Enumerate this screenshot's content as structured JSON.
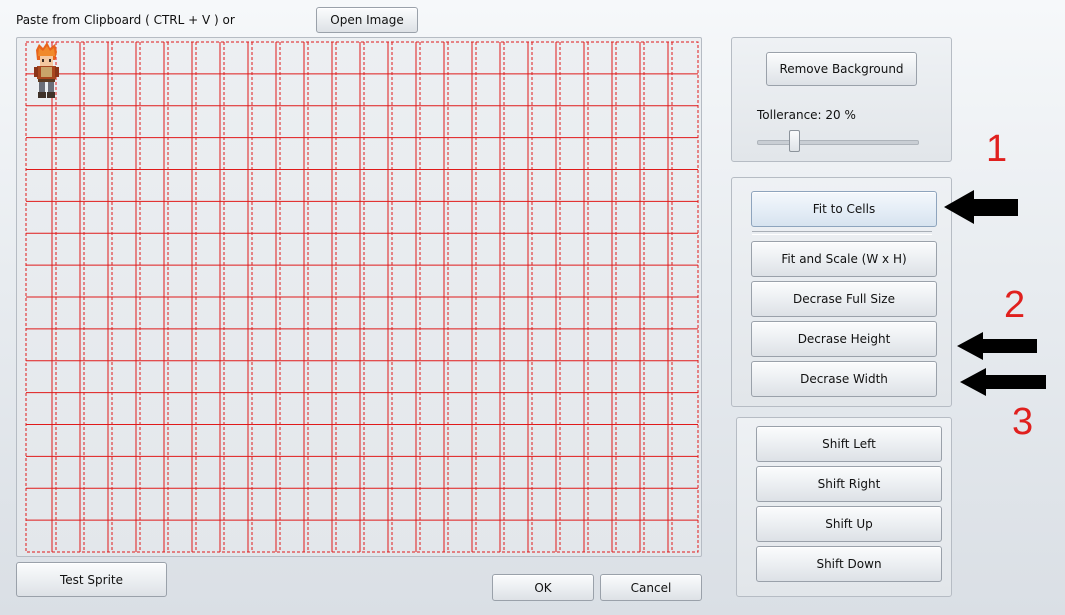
{
  "header": {
    "paste_label": "Paste from Clipboard ( CTRL + V ) or",
    "open_image_label": "Open Image"
  },
  "canvas": {
    "grid_color": "#e01a1a",
    "columns": 24,
    "rows": 16
  },
  "background_panel": {
    "remove_background_label": "Remove Background",
    "tolerance_label": "Tollerance: 20 %",
    "tolerance_percent": 20
  },
  "fit_panel": {
    "fit_to_cells_label": "Fit to Cells",
    "fit_and_scale_label": "Fit and Scale (W x H)",
    "decrease_full_size_label": "Decrase Full Size",
    "decrease_height_label": "Decrase Height",
    "decrease_width_label": "Decrase Width"
  },
  "shift_panel": {
    "shift_left_label": "Shift Left",
    "shift_right_label": "Shift Right",
    "shift_up_label": "Shift Up",
    "shift_down_label": "Shift Down"
  },
  "footer": {
    "test_sprite_label": "Test Sprite",
    "ok_label": "OK",
    "cancel_label": "Cancel"
  },
  "annotations": {
    "step1": "1",
    "step2": "2",
    "step3": "3",
    "color": "#e0201e",
    "arrow_color": "#000000"
  }
}
